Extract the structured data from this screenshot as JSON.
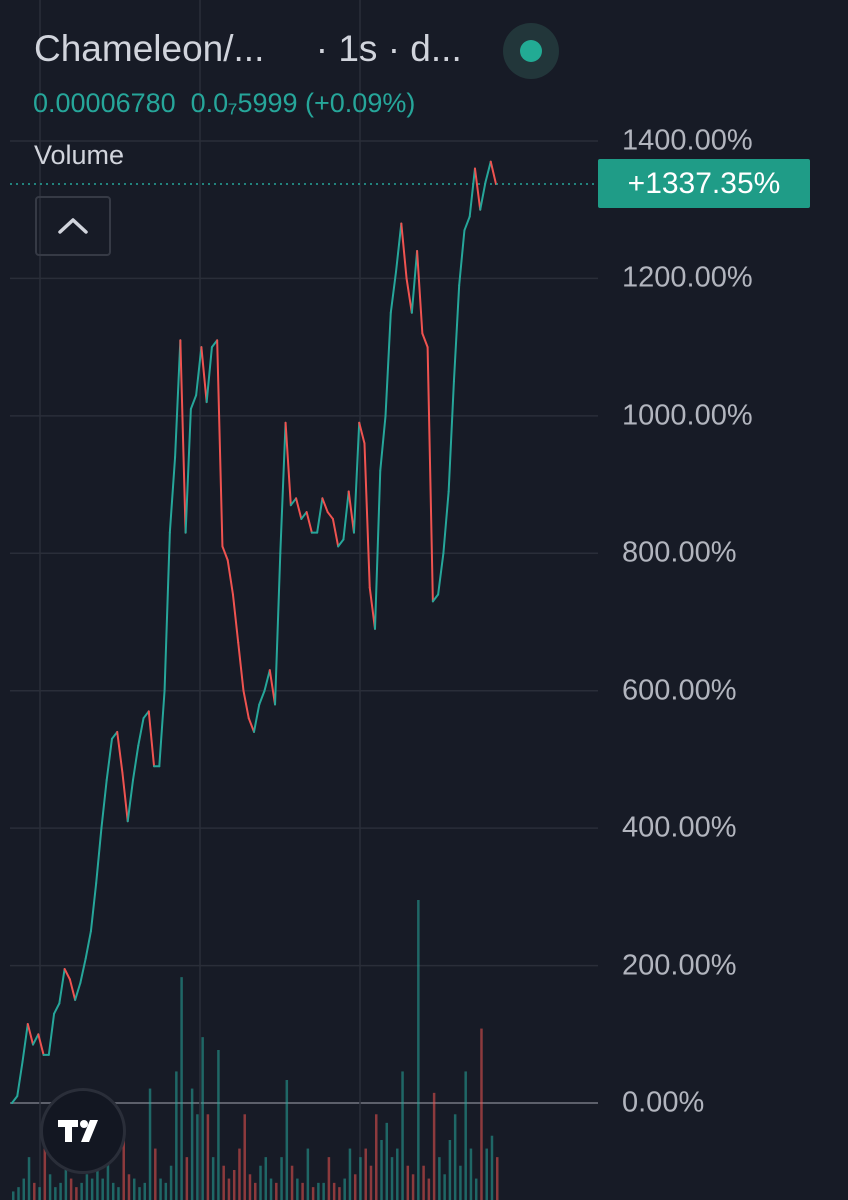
{
  "header": {
    "title": "Chameleon/...     · 1s · d...",
    "price_line": "0.00006780  0.0₇5999 (+0.09%)",
    "live_indicator": "live-dot"
  },
  "volume_label": "Volume",
  "collapse_button_icon": "chevron-up-icon",
  "current_value_label": "+1337.35%",
  "logo": "tradingview-logo",
  "colors": {
    "background": "#171b26",
    "up": "#26a69a",
    "down": "#ef5350",
    "grid": "#2a2e39",
    "tag": "#1f9c87"
  },
  "chart_data": {
    "type": "line",
    "y_unit": "%",
    "ylim": [
      0,
      1400
    ],
    "y_ticks": [
      "1400.00%",
      "1200.00%",
      "1000.00%",
      "800.00%",
      "600.00%",
      "400.00%",
      "200.00%",
      "0.00%"
    ],
    "y_tick_values": [
      1400,
      1200,
      1000,
      800,
      600,
      400,
      200,
      0
    ],
    "grid": true,
    "current_value": 1337.35,
    "series": [
      {
        "values": [
          0,
          10,
          60,
          115,
          85,
          100,
          70,
          70,
          130,
          145,
          195,
          180,
          150,
          175,
          210,
          250,
          320,
          400,
          470,
          530,
          540,
          480,
          410,
          470,
          520,
          560,
          570,
          490,
          490,
          600,
          830,
          940,
          1110,
          830,
          1010,
          1030,
          1100,
          1020,
          1100,
          1110,
          810,
          790,
          740,
          670,
          600,
          560,
          540,
          580,
          600,
          630,
          580,
          800,
          990,
          870,
          880,
          850,
          860,
          830,
          830,
          880,
          860,
          850,
          810,
          820,
          890,
          830,
          990,
          960,
          750,
          690,
          920,
          1000,
          1150,
          1210,
          1280,
          1200,
          1150,
          1240,
          1120,
          1100,
          730,
          740,
          800,
          890,
          1050,
          1190,
          1270,
          1290,
          1360,
          1300,
          1340,
          1370,
          1337.35
        ]
      }
    ],
    "volume": [
      2,
      3,
      5,
      10,
      4,
      3,
      12,
      6,
      3,
      4,
      15,
      5,
      3,
      4,
      6,
      5,
      8,
      5,
      10,
      4,
      3,
      14,
      6,
      5,
      3,
      4,
      26,
      12,
      5,
      4,
      8,
      30,
      52,
      10,
      26,
      20,
      38,
      20,
      10,
      35,
      8,
      5,
      7,
      12,
      20,
      6,
      4,
      8,
      10,
      5,
      4,
      10,
      28,
      8,
      5,
      4,
      12,
      3,
      4,
      4,
      10,
      4,
      3,
      5,
      12,
      6,
      10,
      12,
      8,
      20,
      14,
      18,
      10,
      12,
      30,
      8,
      6,
      70,
      8,
      5,
      25,
      10,
      6,
      14,
      20,
      8,
      30,
      12,
      5,
      40,
      12,
      15,
      10
    ]
  }
}
